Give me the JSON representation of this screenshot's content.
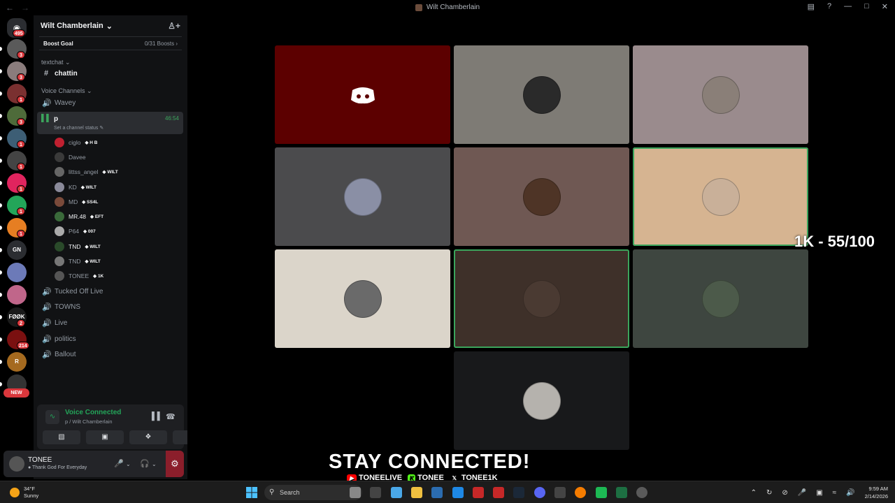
{
  "titlebar": {
    "title": "Wilt Chamberlain"
  },
  "guilds": {
    "home_badge": "495",
    "items": [
      {
        "badge": "3",
        "color": "#5a5a5a"
      },
      {
        "badge": "3",
        "color": "#8a7c7c"
      },
      {
        "badge": "1",
        "color": "#7a3030"
      },
      {
        "badge": "3",
        "color": "#4e6b3a"
      },
      {
        "badge": "1",
        "color": "#3d5e75"
      },
      {
        "badge": "1",
        "color": "#444444"
      },
      {
        "badge": "1",
        "color": "#e0245e"
      },
      {
        "badge": "1",
        "color": "#23a559"
      },
      {
        "badge": "1",
        "color": "#e67e22"
      },
      {
        "badge": "",
        "color": "#2b2d31",
        "text": "GN"
      },
      {
        "badge": "",
        "color": "#6c7ab8"
      },
      {
        "badge": "",
        "color": "#c0668a"
      },
      {
        "badge": "2",
        "color": "#1a1a1a",
        "text": "FØØK"
      },
      {
        "badge": "214",
        "color": "#7a1010"
      },
      {
        "badge": "",
        "color": "#a56a1f",
        "text": "R"
      },
      {
        "badge": "",
        "color": "#333333"
      }
    ],
    "new_label": "NEW"
  },
  "server": {
    "name": "Wilt Chamberlain",
    "boost_goal": "Boost Goal",
    "boost_count": "0/31 Boosts",
    "text_category": "textchat",
    "text_channel": "chattin",
    "voice_category": "Voice Channels",
    "voice_channels_top": [
      "Wavey"
    ],
    "active_channel": {
      "name": "p",
      "status": "Set a channel status",
      "timer": "46:54"
    },
    "members": [
      {
        "name": "ciglo",
        "tag": "H B",
        "color": "#c02030",
        "bright": false
      },
      {
        "name": "Davee",
        "tag": "",
        "color": "#3a3a3a",
        "bright": false
      },
      {
        "name": "littss_angel",
        "tag": "WILT",
        "color": "#666666",
        "bright": false
      },
      {
        "name": "KD",
        "tag": "WILT",
        "color": "#8a8a9a",
        "bright": false
      },
      {
        "name": "MD",
        "tag": "SS4L",
        "color": "#7a4a3a",
        "bright": false
      },
      {
        "name": "MR.48",
        "tag": "EFT",
        "color": "#3a6a3a",
        "bright": true
      },
      {
        "name": "P64",
        "tag": "007",
        "color": "#aaaaaa",
        "bright": false
      },
      {
        "name": "TND",
        "tag": "WILT",
        "color": "#2a4a2a",
        "bright": true
      },
      {
        "name": "TND",
        "tag": "WILT",
        "color": "#777777",
        "bright": false
      },
      {
        "name": "TONEE",
        "tag": "1K",
        "color": "#555555",
        "bright": false
      }
    ],
    "voice_channels_bottom": [
      "Tucked Off Live",
      "TOWNS",
      "Live",
      "politics",
      "Ballout"
    ]
  },
  "voice_panel": {
    "status": "Voice Connected",
    "location": "p / Wilt Chamberlain"
  },
  "user_panel": {
    "name": "TONEE",
    "status": "Thank God For Everyday"
  },
  "tiles": [
    {
      "bg": "#5c0000",
      "avatar": "discord",
      "speaking": false
    },
    {
      "bg": "#7e7b75",
      "avatar": "#2a2a2a",
      "speaking": false
    },
    {
      "bg": "#9a8b8d",
      "avatar": "#8a7f78",
      "speaking": false
    },
    {
      "bg": "#4b4b4d",
      "avatar": "#8a8fa5",
      "speaking": false
    },
    {
      "bg": "#6f5853",
      "avatar": "#4e3426",
      "speaking": false
    },
    {
      "bg": "#d6b491",
      "avatar": "#c9b099",
      "speaking": true
    },
    {
      "bg": "#dbd5ca",
      "avatar": "#6a6a6a",
      "speaking": false
    },
    {
      "bg": "#3e3029",
      "avatar": "#4a3a32",
      "speaking": true
    },
    {
      "bg": "#3e4640",
      "avatar": "#4c5a4a",
      "speaking": false
    },
    {
      "bg": "#18191b",
      "avatar": "#b5b2ad",
      "speaking": false
    }
  ],
  "overlay": {
    "counter": "1K - 55/100",
    "headline": "STAY CONNECTED!",
    "socials": [
      {
        "platform": "youtube",
        "handle": "TONEELIVE"
      },
      {
        "platform": "kick",
        "handle": "TONEE"
      },
      {
        "platform": "x",
        "handle": "TONEE1K"
      }
    ]
  },
  "taskbar": {
    "temperature": "34°F",
    "condition": "Sunny",
    "search_placeholder": "Search",
    "time": "9:59 AM",
    "date": "2/14/2026"
  }
}
